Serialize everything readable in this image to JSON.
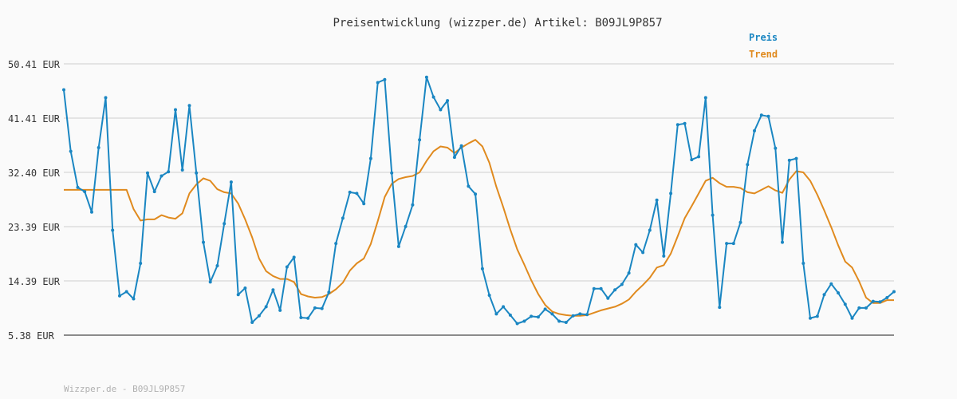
{
  "chart_data": {
    "type": "line",
    "title": "Preisentwicklung (wizzper.de) Artikel: B09JL9P857",
    "footer": "Wizzper.de - B09JL9P857",
    "y_ticks": [
      "50.41 EUR",
      "41.41 EUR",
      "32.40 EUR",
      "23.39 EUR",
      "14.39 EUR",
      "5.38 EUR"
    ],
    "ylim": [
      5.38,
      50.41
    ],
    "legend_position": "top-right",
    "series": [
      {
        "name": "Preis",
        "color": "#1a86c2",
        "values": [
          46.1,
          35.9,
          29.9,
          29.2,
          25.8,
          36.5,
          44.8,
          22.8,
          11.9,
          12.6,
          11.4,
          17.3,
          32.3,
          29.2,
          31.8,
          32.5,
          42.8,
          32.8,
          43.5,
          32.3,
          20.8,
          14.2,
          16.9,
          23.9,
          30.8,
          12.1,
          13.2,
          7.5,
          8.6,
          10.1,
          12.9,
          9.5,
          16.7,
          18.3,
          8.3,
          8.2,
          9.9,
          9.8,
          12.5,
          20.6,
          24.8,
          29.1,
          28.9,
          27.2,
          34.7,
          47.3,
          47.8,
          32.3,
          20.1,
          23.4,
          27.0,
          37.8,
          48.2,
          44.9,
          42.8,
          44.3,
          34.9,
          36.8,
          30.1,
          28.8,
          16.4,
          12.0,
          8.9,
          10.1,
          8.7,
          7.3,
          7.7,
          8.5,
          8.4,
          9.7,
          8.9,
          7.7,
          7.5,
          8.6,
          8.9,
          8.8,
          13.1,
          13.1,
          11.5,
          12.9,
          13.8,
          15.7,
          20.4,
          19.1,
          22.8,
          27.8,
          18.5,
          28.9,
          40.3,
          40.5,
          34.5,
          35.0,
          44.8,
          25.3,
          10.0,
          20.6,
          20.6,
          24.1,
          33.7,
          39.3,
          41.9,
          41.7,
          36.4,
          20.8,
          34.4,
          34.7,
          17.3,
          8.2,
          8.5,
          12.1,
          13.9,
          12.4,
          10.5,
          8.2,
          9.9,
          9.9,
          11.0,
          10.9,
          11.6,
          12.6
        ]
      },
      {
        "name": "Trend",
        "color": "#e08a1e",
        "values": [
          29.5,
          29.5,
          29.5,
          29.5,
          29.5,
          29.5,
          29.5,
          29.5,
          29.5,
          29.5,
          26.3,
          24.4,
          24.6,
          24.6,
          25.3,
          24.9,
          24.7,
          25.6,
          28.9,
          30.4,
          31.4,
          31.0,
          29.6,
          29.1,
          28.9,
          27.2,
          24.6,
          21.6,
          18.1,
          16.0,
          15.2,
          14.7,
          14.7,
          14.2,
          12.2,
          11.8,
          11.6,
          11.7,
          12.2,
          13.0,
          14.1,
          16.1,
          17.3,
          18.1,
          20.5,
          24.3,
          28.3,
          30.5,
          31.3,
          31.6,
          31.8,
          32.4,
          34.3,
          35.9,
          36.7,
          36.5,
          35.6,
          36.5,
          37.2,
          37.8,
          36.7,
          34.0,
          30.0,
          26.6,
          22.9,
          19.6,
          17.1,
          14.5,
          12.2,
          10.4,
          9.3,
          8.9,
          8.7,
          8.6,
          8.6,
          8.7,
          9.1,
          9.5,
          9.8,
          10.1,
          10.6,
          11.3,
          12.6,
          13.7,
          14.9,
          16.6,
          17.0,
          18.9,
          21.8,
          24.8,
          26.8,
          28.9,
          31.0,
          31.5,
          30.6,
          30.0,
          30.0,
          29.8,
          29.1,
          28.9,
          29.5,
          30.1,
          29.4,
          29.0,
          31.2,
          32.6,
          32.4,
          31.0,
          28.7,
          26.1,
          23.3,
          20.3,
          17.6,
          16.6,
          14.3,
          11.6,
          10.7,
          10.7,
          11.2,
          11.2
        ]
      }
    ]
  }
}
